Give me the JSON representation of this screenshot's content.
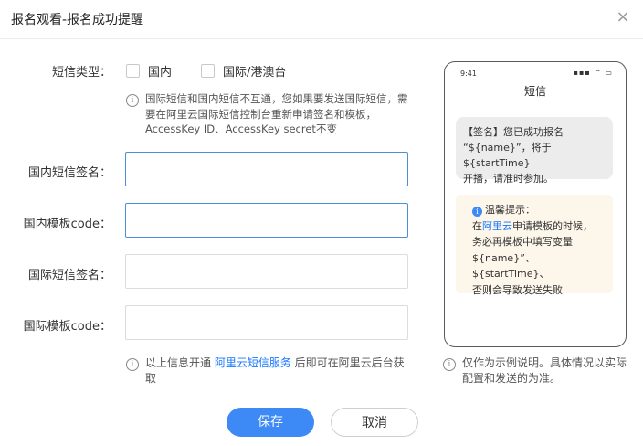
{
  "dialog": {
    "title": "报名观看-报名成功提醒",
    "close_icon": "×"
  },
  "form": {
    "sms_type_label": "短信类型：",
    "options": [
      {
        "label": "国内",
        "checked": false
      },
      {
        "label": "国际/港澳台",
        "checked": false
      }
    ],
    "intl_note": [
      "国际短信和国内短信不互通，您如果要发送国际短信，需",
      "要在阿里云国际短信控制台重新申请签名和模板，",
      "AccessKey ID、AccessKey secret不变"
    ],
    "fields": [
      {
        "label": "国内短信签名：",
        "value": ""
      },
      {
        "label": "国内模板code：",
        "value": ""
      },
      {
        "label": "国际短信签名：",
        "value": ""
      },
      {
        "label": "国际模板code：",
        "value": ""
      }
    ],
    "bottom_note": {
      "prefix": "以上信息开通 ",
      "link": "阿里云短信服务",
      "suffix": " 后即可在阿里云后台获",
      "line2": "取"
    }
  },
  "phone": {
    "time": "9:41",
    "status": "▪▪▪ ⌔ ▭",
    "title": "短信",
    "message": [
      "【签名】您已成功报名",
      "“${name}”，将于${startTime}",
      "开播，请准时参加。"
    ],
    "tip_title": "温馨提示：",
    "tip": {
      "prefix": "在",
      "link": "阿里云",
      "suffix": "申请模板的时候，",
      "lines": [
        "务必再模板中填写变量",
        "${name}”、${startTime}、",
        "否则会导致发送失败"
      ]
    }
  },
  "side_note": [
    "仅作为示例说明。具体情况以实际",
    "配置和发送的为准。"
  ],
  "buttons": {
    "save": "保存",
    "cancel": "取消"
  },
  "colors": {
    "primary": "#3d8af7",
    "link": "#1677ff",
    "tip_bg": "#fdf6ea"
  }
}
